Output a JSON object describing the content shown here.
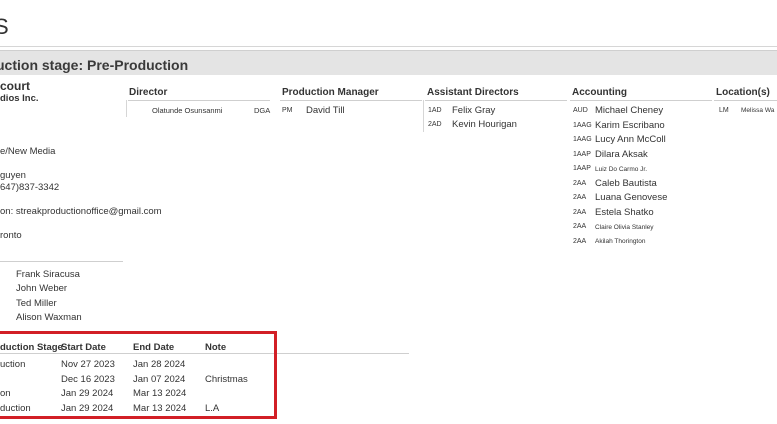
{
  "header": {
    "title_fragment": "S"
  },
  "stage": {
    "text": "uction stage:  Pre-Production"
  },
  "company": {
    "line1": "court",
    "line2": "dios Inc."
  },
  "info": {
    "type": "e/New Media",
    "contact_name": "guyen",
    "contact_phone": "647)837-3342",
    "email_line": "on: streakproductionoffice@gmail.com",
    "city": "ronto"
  },
  "people": [
    "Frank Siracusa",
    "John Weber",
    "Ted Miller",
    "Alison Waxman"
  ],
  "columns": {
    "director": {
      "heading": "Director",
      "rows": [
        {
          "name": "Olatunde  Osunsanmi",
          "union": "DGA"
        }
      ]
    },
    "production_manager": {
      "heading": "Production Manager",
      "rows": [
        {
          "role": "PM",
          "name": "David Till"
        }
      ]
    },
    "assistant_directors": {
      "heading": "Assistant Directors",
      "rows": [
        {
          "role": "1AD",
          "name": "Felix Gray"
        },
        {
          "role": "2AD",
          "name": "Kevin Hourigan"
        }
      ]
    },
    "accounting": {
      "heading": "Accounting",
      "rows": [
        {
          "role": "AUD",
          "name": "Michael Cheney"
        },
        {
          "role": "1AAG",
          "name": "Karim Escribano"
        },
        {
          "role": "1AAG",
          "name": "Lucy Ann McColl"
        },
        {
          "role": "1AAP",
          "name": "Dilara Aksak"
        },
        {
          "role": "1AAP",
          "name": "Luiz Do Carmo Jr."
        },
        {
          "role": "2AA",
          "name": "Caleb Bautista"
        },
        {
          "role": "2AA",
          "name": "Luana Genovese"
        },
        {
          "role": "2AA",
          "name": "Estela Shatko"
        },
        {
          "role": "2AA",
          "name": "Claire Olivia Stanley"
        },
        {
          "role": "2AA",
          "name": "Akilah Thorington"
        }
      ]
    },
    "locations": {
      "heading": "Location(s)",
      "rows": [
        {
          "role": "LM",
          "name": "Melissa Wa"
        }
      ]
    }
  },
  "schedule": {
    "headers": [
      "duction Stage",
      "Start Date",
      "End Date",
      "Note"
    ],
    "rows": [
      {
        "stage": "uction",
        "start": "Nov 27 2023",
        "end": "Jan 28 2024",
        "note": ""
      },
      {
        "stage": "",
        "start": "Dec 16 2023",
        "end": "Jan 07 2024",
        "note": "Christmas"
      },
      {
        "stage": "on",
        "start": "Jan 29 2024",
        "end": "Mar 13 2024",
        "note": ""
      },
      {
        "stage": "duction",
        "start": "Jan 29 2024",
        "end": "Mar 13 2024",
        "note": "L.A"
      }
    ]
  }
}
